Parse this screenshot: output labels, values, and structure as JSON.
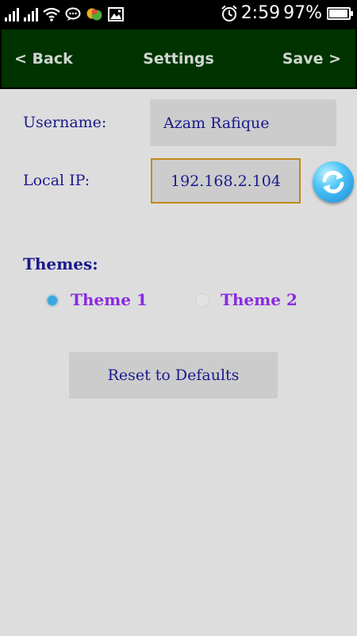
{
  "status_bar": {
    "time": "2:59",
    "battery_text": "97%",
    "battery_level": 0.97,
    "icons": [
      "signal-icon",
      "signal-icon",
      "wifi-icon",
      "chat-icon",
      "messenger-icon",
      "image-icon",
      "alarm-icon",
      "battery-icon"
    ]
  },
  "action_bar": {
    "back_label": "< Back",
    "title": "Settings",
    "save_label": "Save >",
    "background": "#003300"
  },
  "form": {
    "username_label": "Username:",
    "username_value": "Azam Rafique",
    "local_ip_label": "Local IP:",
    "local_ip_value": "192.168.2.104",
    "focus_color": "#c08a1a"
  },
  "themes": {
    "title": "Themes:",
    "options": [
      {
        "label": "Theme 1",
        "selected": true
      },
      {
        "label": "Theme 2",
        "selected": false
      }
    ],
    "label_color": "#8a2be2"
  },
  "reset_label": "Reset to Defaults",
  "colors": {
    "text": "#1a1a8c",
    "background": "#dddddd"
  }
}
